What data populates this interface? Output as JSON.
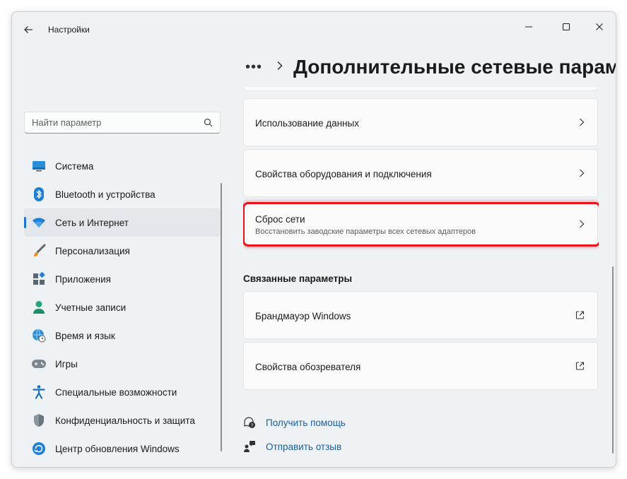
{
  "window": {
    "title": "Настройки"
  },
  "search": {
    "placeholder": "Найти параметр"
  },
  "sidebar": {
    "items": [
      {
        "label": "Система",
        "icon": "monitor-icon"
      },
      {
        "label": "Bluetooth и устройства",
        "icon": "bluetooth-icon"
      },
      {
        "label": "Сеть и Интернет",
        "icon": "wifi-icon",
        "selected": true
      },
      {
        "label": "Персонализация",
        "icon": "brush-icon"
      },
      {
        "label": "Приложения",
        "icon": "apps-icon"
      },
      {
        "label": "Учетные записи",
        "icon": "person-icon"
      },
      {
        "label": "Время и язык",
        "icon": "globe-clock-icon"
      },
      {
        "label": "Игры",
        "icon": "gamepad-icon"
      },
      {
        "label": "Специальные возможности",
        "icon": "accessibility-icon"
      },
      {
        "label": "Конфиденциальность и защита",
        "icon": "shield-icon"
      },
      {
        "label": "Центр обновления Windows",
        "icon": "update-icon"
      }
    ]
  },
  "breadcrumb": {
    "dots": "•••",
    "title": "Дополнительные сетевые парам"
  },
  "cards": {
    "data_usage": "Использование данных",
    "hardware": "Свойства оборудования и подключения",
    "reset": {
      "title": "Сброс сети",
      "subtitle": "Восстановить заводские параметры всех сетевых адаптеров"
    }
  },
  "related": {
    "heading": "Связанные параметры",
    "firewall": "Брандмауэр Windows",
    "browser": "Свойства обозревателя"
  },
  "help": {
    "get_help": "Получить помощь",
    "feedback": "Отправить отзыв"
  },
  "colors": {
    "accent": "#1a73c8",
    "highlight": "#e8141c",
    "link": "#1a5fa3"
  }
}
